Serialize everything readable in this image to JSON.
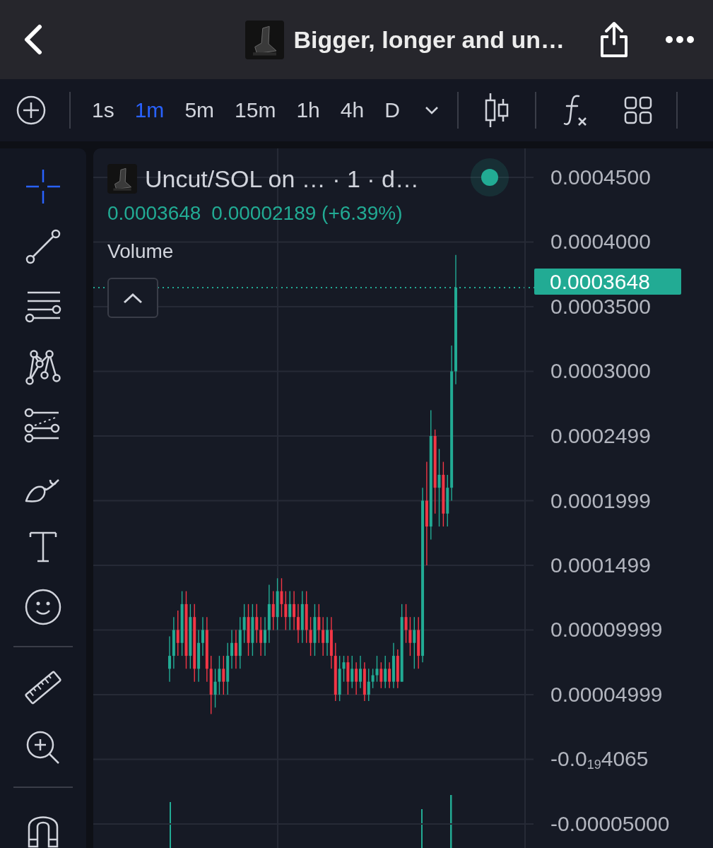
{
  "header": {
    "title": "Bigger, longer and un…"
  },
  "timeframes": [
    {
      "label": "1s",
      "selected": false
    },
    {
      "label": "1m",
      "selected": true
    },
    {
      "label": "5m",
      "selected": false
    },
    {
      "label": "15m",
      "selected": false
    },
    {
      "label": "1h",
      "selected": false
    },
    {
      "label": "4h",
      "selected": false
    },
    {
      "label": "D",
      "selected": false
    }
  ],
  "drawing_tools": [
    {
      "tools": [
        {
          "kind": "crosshair",
          "selected": true
        },
        {
          "kind": "trend_line",
          "selected": false
        },
        {
          "kind": "horizontal_lines",
          "selected": false
        },
        {
          "kind": "pattern",
          "selected": false
        },
        {
          "kind": "fib",
          "selected": false
        },
        {
          "kind": "brush",
          "selected": false
        },
        {
          "kind": "text",
          "selected": false
        },
        {
          "kind": "emoji",
          "selected": false
        }
      ]
    },
    {
      "tools": [
        {
          "kind": "ruler",
          "selected": false
        },
        {
          "kind": "zoom",
          "selected": false
        }
      ]
    },
    {
      "tools": [
        {
          "kind": "magnet",
          "selected": false
        }
      ]
    }
  ],
  "legend": {
    "symbol": "Uncut/SOL on … · 1 · d…",
    "price": "0.0003648",
    "change": "0.00002189 (+6.39%)",
    "indicator": "Volume"
  },
  "chart_data": {
    "type": "candlestick",
    "ohlc": [
      [
        7e-05,
        9.5e-05,
        6e-05,
        8e-05
      ],
      [
        8e-05,
        0.00011,
        7e-05,
        0.0001
      ],
      [
        0.0001,
        0.000115,
        8e-05,
        9e-05
      ],
      [
        9e-05,
        0.00013,
        8e-05,
        0.00012
      ],
      [
        0.00012,
        0.00013,
        7e-05,
        8e-05
      ],
      [
        8e-05,
        0.00012,
        7e-05,
        0.00011
      ],
      [
        0.00011,
        0.00012,
        6e-05,
        7e-05
      ],
      [
        7e-05,
        0.0001,
        6e-05,
        9e-05
      ],
      [
        9e-05,
        0.00011,
        8e-05,
        0.0001
      ],
      [
        0.0001,
        0.00011,
        6e-05,
        7e-05
      ],
      [
        7e-05,
        8e-05,
        3.5e-05,
        5e-05
      ],
      [
        5e-05,
        7e-05,
        4e-05,
        6e-05
      ],
      [
        6e-05,
        8e-05,
        5e-05,
        7e-05
      ],
      [
        7e-05,
        8e-05,
        5e-05,
        6e-05
      ],
      [
        6e-05,
        9e-05,
        5e-05,
        8e-05
      ],
      [
        8e-05,
        0.0001,
        7e-05,
        9e-05
      ],
      [
        9e-05,
        0.0001,
        7e-05,
        8e-05
      ],
      [
        8e-05,
        0.00011,
        7e-05,
        0.0001
      ],
      [
        0.0001,
        0.00012,
        9e-05,
        0.00011
      ],
      [
        0.00011,
        0.00012,
        8e-05,
        9e-05
      ],
      [
        9e-05,
        0.00012,
        8e-05,
        0.00011
      ],
      [
        0.00011,
        0.00012,
        9e-05,
        0.0001
      ],
      [
        0.0001,
        0.00011,
        8e-05,
        9e-05
      ],
      [
        9e-05,
        0.00011,
        8e-05,
        0.0001
      ],
      [
        0.0001,
        0.000135,
        9e-05,
        0.00012
      ],
      [
        0.00012,
        0.00013,
        0.0001,
        0.00011
      ],
      [
        0.00011,
        0.00014,
        0.0001,
        0.00013
      ],
      [
        0.00013,
        0.00014,
        0.00011,
        0.00012
      ],
      [
        0.00012,
        0.00013,
        0.0001,
        0.00011
      ],
      [
        0.00011,
        0.00013,
        0.0001,
        0.00012
      ],
      [
        0.00012,
        0.00013,
        0.0001,
        0.00011
      ],
      [
        0.00011,
        0.00012,
        9e-05,
        0.0001
      ],
      [
        0.0001,
        0.00013,
        9e-05,
        0.00012
      ],
      [
        0.00012,
        0.00013,
        9e-05,
        0.0001
      ],
      [
        0.0001,
        0.00011,
        8e-05,
        9e-05
      ],
      [
        9e-05,
        0.00012,
        8e-05,
        0.00011
      ],
      [
        0.00011,
        0.00012,
        9e-05,
        0.0001
      ],
      [
        0.0001,
        0.00011,
        8e-05,
        9e-05
      ],
      [
        9e-05,
        0.00011,
        8e-05,
        0.0001
      ],
      [
        0.0001,
        0.00011,
        7e-05,
        8e-05
      ],
      [
        8e-05,
        9e-05,
        4.5e-05,
        5e-05
      ],
      [
        5e-05,
        8e-05,
        4.5e-05,
        7e-05
      ],
      [
        7e-05,
        8e-05,
        6e-05,
        7.5e-05
      ],
      [
        7.5e-05,
        8e-05,
        5e-05,
        6e-05
      ],
      [
        6e-05,
        8e-05,
        5.5e-05,
        7e-05
      ],
      [
        7e-05,
        7.5e-05,
        5e-05,
        6e-05
      ],
      [
        6e-05,
        8e-05,
        5.5e-05,
        7e-05
      ],
      [
        7e-05,
        7.5e-05,
        4.5e-05,
        5e-05
      ],
      [
        5e-05,
        7e-05,
        4.5e-05,
        6e-05
      ],
      [
        6e-05,
        7e-05,
        5.5e-05,
        6.5e-05
      ],
      [
        6.5e-05,
        8e-05,
        6e-05,
        7e-05
      ],
      [
        7e-05,
        7.5e-05,
        5.5e-05,
        6e-05
      ],
      [
        6e-05,
        8e-05,
        5.5e-05,
        7e-05
      ],
      [
        7e-05,
        7.5e-05,
        5.5e-05,
        6e-05
      ],
      [
        6e-05,
        9e-05,
        5.5e-05,
        8e-05
      ],
      [
        8e-05,
        8.5e-05,
        5.5e-05,
        6e-05
      ],
      [
        6e-05,
        0.00012,
        6e-05,
        0.00011
      ],
      [
        0.00011,
        0.00012,
        9e-05,
        0.0001
      ],
      [
        0.0001,
        0.00011,
        8e-05,
        9e-05
      ],
      [
        9e-05,
        0.00011,
        7e-05,
        0.0001
      ],
      [
        0.0001,
        0.00011,
        7e-05,
        8e-05
      ],
      [
        8e-05,
        0.00021,
        7.5e-05,
        0.0002
      ],
      [
        0.0002,
        0.00023,
        0.00015,
        0.00018
      ],
      [
        0.00018,
        0.00027,
        0.00017,
        0.00025
      ],
      [
        0.00025,
        0.000255,
        0.00019,
        0.00021
      ],
      [
        0.00021,
        0.00024,
        0.00018,
        0.00022
      ],
      [
        0.00022,
        0.00023,
        0.00018,
        0.00019
      ],
      [
        0.00019,
        0.00022,
        0.00018,
        0.00021
      ],
      [
        0.00021,
        0.00032,
        0.0002,
        0.0003
      ],
      [
        0.0003,
        0.00039,
        0.00029,
        0.0003648
      ]
    ],
    "grid": true,
    "ylim": [
      -6.86e-05,
      0.0004724
    ],
    "yticks": [
      {
        "value": 0.00045,
        "label": "0.0004500"
      },
      {
        "value": 0.0004,
        "label": "0.0004000"
      },
      {
        "value": 0.00035,
        "label": "0.0003500"
      },
      {
        "value": 0.0003,
        "label": "0.0003000"
      },
      {
        "value": 0.0002499,
        "label": "0.0002499"
      },
      {
        "value": 0.0001999,
        "label": "0.0001999"
      },
      {
        "value": 0.0001499,
        "label": "0.0001499"
      },
      {
        "value": 9.999e-05,
        "label": "0.00009999"
      },
      {
        "value": 4.999e-05,
        "label": "0.00004999"
      },
      {
        "value": -4.065e-20,
        "label": "-0.0$_{19}$4065"
      },
      {
        "value": -5e-05,
        "label": "-0.00005000"
      }
    ]
  },
  "last_price_tag": "0.0003648"
}
